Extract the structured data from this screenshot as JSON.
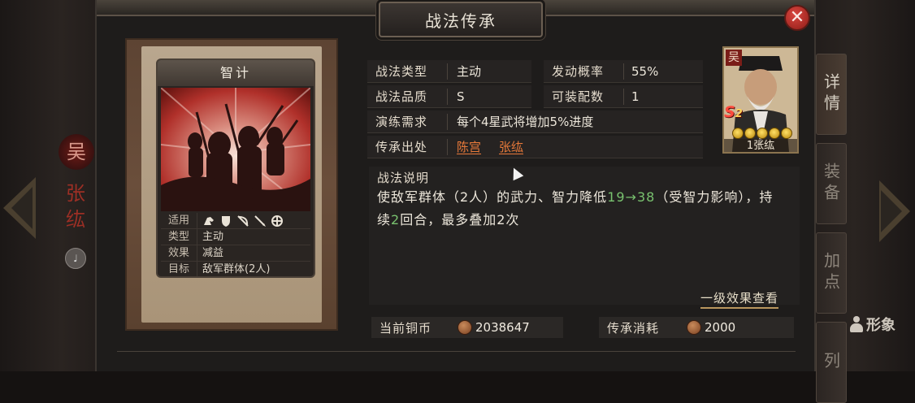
{
  "dialog": {
    "title": "战法传承",
    "close_icon": "close-icon"
  },
  "card": {
    "title": "智计",
    "stats": [
      {
        "key": "适用",
        "value": "",
        "icons": [
          "cavalry-icon",
          "shield-icon",
          "bow-icon",
          "spear-icon",
          "siege-icon"
        ]
      },
      {
        "key": "类型",
        "value": "主动"
      },
      {
        "key": "效果",
        "value": "减益"
      },
      {
        "key": "目标",
        "value": "敌军群体(2人)"
      }
    ]
  },
  "info": {
    "type_label": "战法类型",
    "type_value": "主动",
    "prob_label": "发动概率",
    "prob_value": "55%",
    "quality_label": "战法品质",
    "quality_value": "S",
    "slots_label": "可装配数",
    "slots_value": "1",
    "train_label": "演练需求",
    "train_value": "每个4星武将增加5%进度",
    "source_label": "传承出处",
    "source_1": "陈宫",
    "source_2": "张纮"
  },
  "description": {
    "title": "战法说明",
    "part1": "使敌军群体（2人）的武力、智力降低",
    "from_value": "19",
    "arrow": "→",
    "to_value": "38",
    "part2": "（受智力影响），持续",
    "turns": "2",
    "part3": "回合，最多叠加2次",
    "first_level_link": "一级效果查看"
  },
  "currency": {
    "current_label": "当前铜币",
    "current_value": "2038647",
    "cost_label": "传承消耗",
    "cost_value": "2000"
  },
  "portrait": {
    "faction": "吴",
    "rank": "S",
    "rank_sub": "2",
    "name": "1张纮",
    "stars": 5
  },
  "background": {
    "hero_faction": "吴",
    "hero_name": "张纮",
    "side_tabs": [
      "详情",
      "装备",
      "加点",
      "列"
    ],
    "image_button": "形象"
  },
  "colors": {
    "link": "#e97a3a",
    "green_value": "#79c26f",
    "close_button": "#c9322c"
  }
}
